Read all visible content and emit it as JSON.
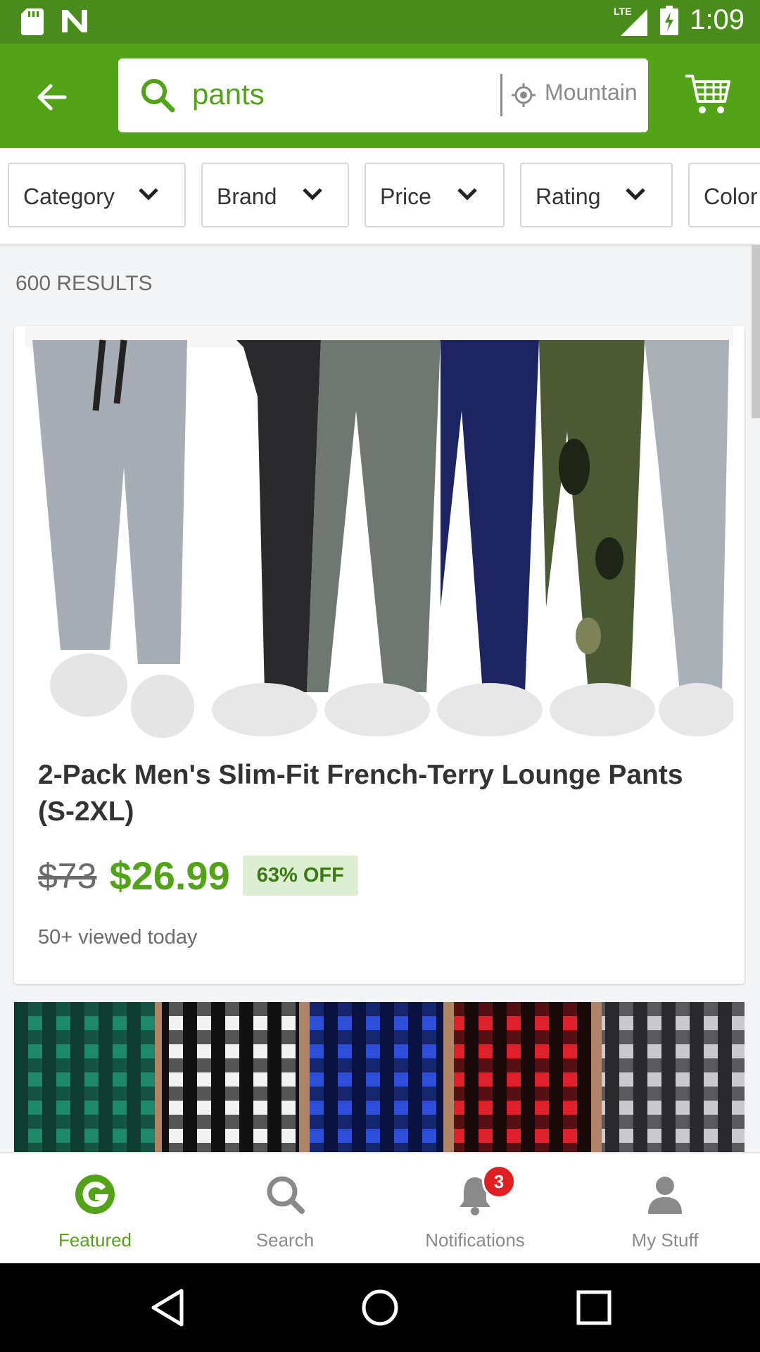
{
  "status_bar": {
    "network_label": "LTE",
    "time": "1:09"
  },
  "app_bar": {
    "search_query": "pants",
    "location": "Mountain"
  },
  "filters": [
    {
      "label": "Category"
    },
    {
      "label": "Brand"
    },
    {
      "label": "Price"
    },
    {
      "label": "Rating"
    },
    {
      "label": "Color"
    }
  ],
  "results": {
    "count_label": "600 RESULTS"
  },
  "products": [
    {
      "title": "2-Pack Men's Slim-Fit French-Terry Lounge Pants (S-2XL)",
      "old_price": "$73",
      "price": "$26.99",
      "discount": "63% OFF",
      "viewed": "50+ viewed today"
    }
  ],
  "bottom_nav": {
    "items": [
      {
        "label": "Featured",
        "icon": "g-logo-icon",
        "active": true
      },
      {
        "label": "Search",
        "icon": "search-icon",
        "active": false
      },
      {
        "label": "Notifications",
        "icon": "bell-icon",
        "active": false
      },
      {
        "label": "My Stuff",
        "icon": "person-icon",
        "active": false
      }
    ],
    "notifications_badge": "3"
  },
  "colors": {
    "brand_green": "#53a318",
    "status_bar_green": "#4a8c1c",
    "badge_red": "#e02020"
  }
}
